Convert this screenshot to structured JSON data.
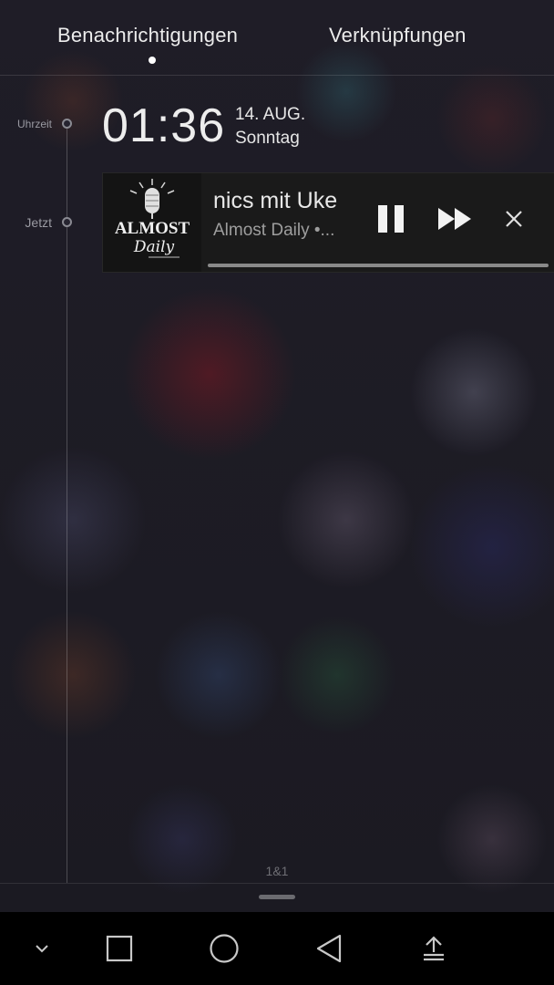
{
  "tabs": {
    "notifications": "Benachrichtigungen",
    "shortcuts": "Verknüpfungen",
    "active": "notifications"
  },
  "timeline": {
    "time_label": "Uhrzeit",
    "now_label": "Jetzt"
  },
  "clock": {
    "time": "01:36",
    "date": "14. AUG.",
    "weekday": "Sonntag"
  },
  "media_notification": {
    "title": "nics mit Uke",
    "subtitle": "Almost Daily •...",
    "artwork_text_1": "ALMOST",
    "artwork_text_2": "Daily",
    "controls": [
      "pause-icon",
      "fast-forward-icon",
      "close-icon"
    ],
    "progress": 1.0
  },
  "footer": {
    "carrier": "1&1"
  },
  "navbar": {
    "buttons": [
      "chevron-down-icon",
      "recents-square-icon",
      "home-circle-icon",
      "back-triangle-icon",
      "upload-icon"
    ]
  },
  "colors": {
    "background": "#1b1a22",
    "card": "#1a1a1a",
    "navbar": "#000000"
  }
}
